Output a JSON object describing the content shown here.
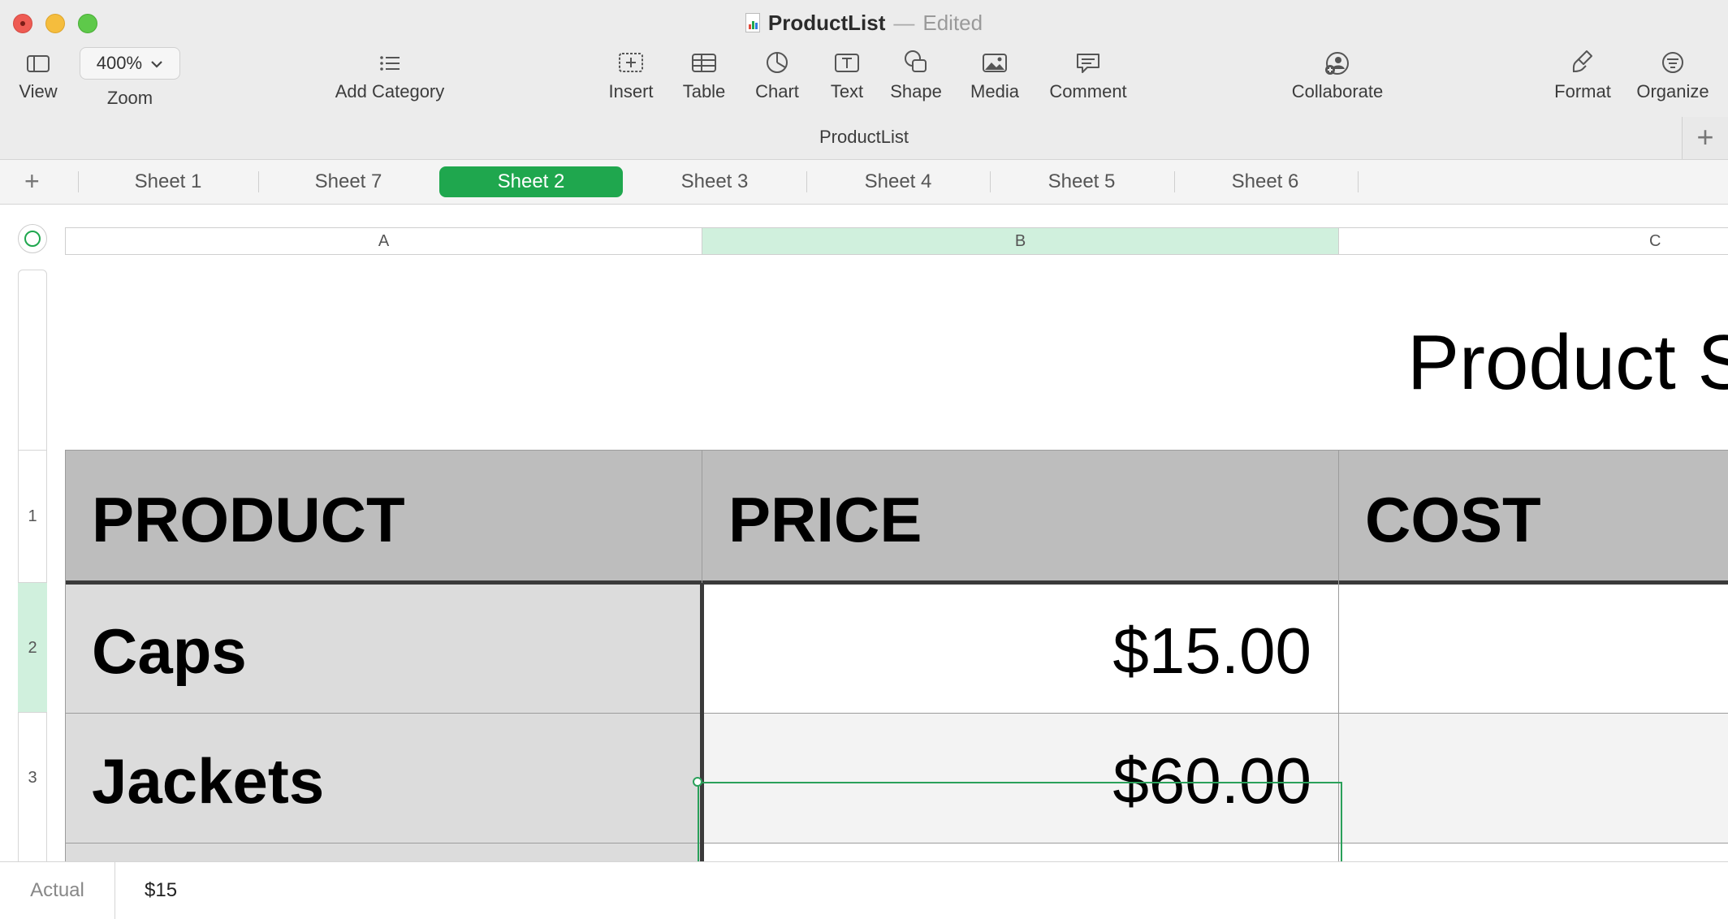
{
  "window": {
    "doc_name": "ProductList",
    "status": "Edited",
    "subtitle": "ProductList"
  },
  "toolbar": {
    "view": "View",
    "zoom_value": "400%",
    "zoom": "Zoom",
    "add_category": "Add Category",
    "insert": "Insert",
    "table": "Table",
    "chart": "Chart",
    "text": "Text",
    "shape": "Shape",
    "media": "Media",
    "comment": "Comment",
    "collaborate": "Collaborate",
    "format": "Format",
    "organize": "Organize",
    "add_sheet": "+"
  },
  "tabs": [
    "Sheet 1",
    "Sheet 7",
    "Sheet 2",
    "Sheet 3",
    "Sheet 4",
    "Sheet 5",
    "Sheet 6"
  ],
  "active_tab": "Sheet 2",
  "accent_color": "#1fa74e",
  "columns": [
    "A",
    "B",
    "C"
  ],
  "rows": [
    "1",
    "2",
    "3"
  ],
  "sheet": {
    "title": "Product S",
    "headers": [
      "PRODUCT",
      "PRICE",
      "COST"
    ],
    "data": [
      {
        "product": "Caps",
        "price": "$15.00",
        "cost": ""
      },
      {
        "product": "Jackets",
        "price": "$60.00",
        "cost": ""
      }
    ]
  },
  "formula_bar": {
    "label": "Actual",
    "value": "$15"
  }
}
